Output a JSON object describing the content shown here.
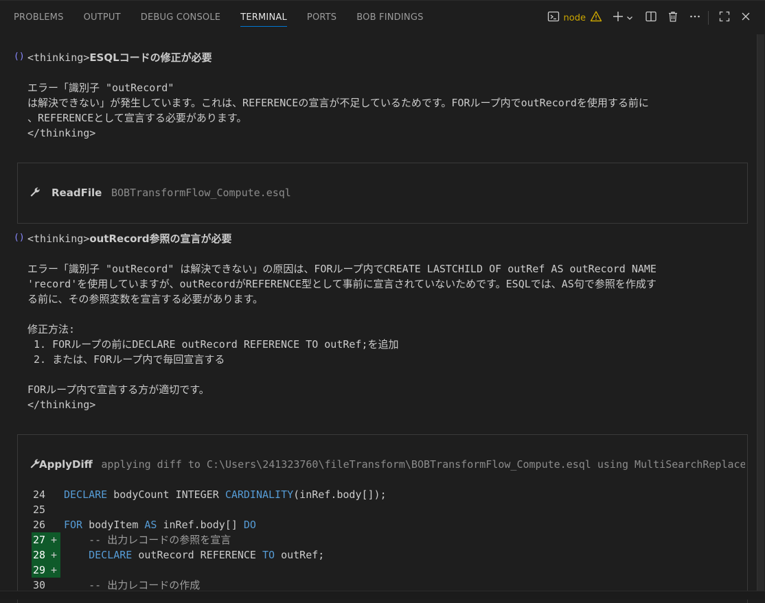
{
  "panel": {
    "tabs": [
      "PROBLEMS",
      "OUTPUT",
      "DEBUG CONSOLE",
      "TERMINAL",
      "PORTS",
      "BOB FINDINGS"
    ],
    "active_tab": "TERMINAL",
    "terminal_name": "node",
    "accent_color": "#0078d4",
    "warning_color": "#cca700"
  },
  "blocks": {
    "thinking1": {
      "open_tag": "<thinking>",
      "heading": "ESQLコードの修正が必要",
      "lines": [
        "エラー「識別子 \"outRecord\"",
        "は解決できない」が発生しています。これは、REFERENCEの宣言が不足しているためです。FORループ内でoutRecordを使用する前に",
        "、REFERENCEとして宣言する必要があります。"
      ],
      "close_tag": "</thinking>"
    },
    "readfile": {
      "tool": "ReadFile",
      "arg": "BOBTransformFlow_Compute.esql"
    },
    "thinking2": {
      "open_tag": "<thinking>",
      "heading": "outRecord参照の宣言が必要",
      "lines": [
        "エラー「識別子 \"outRecord\" は解決できない」の原因は、FORループ内でCREATE LASTCHILD OF outRef AS outRecord NAME",
        "'record'を使用していますが、outRecordがREFERENCE型として事前に宣言されていないためです。ESQLでは、AS句で参照を作成す",
        "る前に、その参照変数を宣言する必要があります。",
        "",
        "修正方法:",
        " 1. FORループの前にDECLARE outRecord REFERENCE TO outRef;を追加",
        " 2. または、FORループ内で毎回宣言する",
        "",
        "FORループ内で宣言する方が適切です。"
      ],
      "close_tag": "</thinking>"
    },
    "applydiff": {
      "tool": "ApplyDiff",
      "arg": "applying diff to C:\\Users\\241323760\\fileTransform\\BOBTransformFlow_Compute.esql using MultiSearchReplace…",
      "code_lines": [
        {
          "num": "24",
          "added": false,
          "tokens": [
            {
              "t": "DECLARE",
              "k": "kw"
            },
            {
              "t": " bodyCount ",
              "k": ""
            },
            {
              "t": "INTEGER",
              "k": ""
            },
            {
              "t": " ",
              "k": ""
            },
            {
              "t": "CARDINALITY",
              "k": "kw"
            },
            {
              "t": "(inRef.body[]);",
              "k": ""
            }
          ]
        },
        {
          "num": "25",
          "added": false,
          "tokens": []
        },
        {
          "num": "26",
          "added": false,
          "tokens": [
            {
              "t": "FOR",
              "k": "kw"
            },
            {
              "t": " bodyItem ",
              "k": ""
            },
            {
              "t": "AS",
              "k": "kw"
            },
            {
              "t": " inRef.body[] ",
              "k": ""
            },
            {
              "t": "DO",
              "k": "kw"
            }
          ]
        },
        {
          "num": "27",
          "added": true,
          "tokens": [
            {
              "t": "    -- 出力レコードの参照を宣言",
              "k": "cmt"
            }
          ]
        },
        {
          "num": "28",
          "added": true,
          "tokens": [
            {
              "t": "    ",
              "k": ""
            },
            {
              "t": "DECLARE",
              "k": "kw"
            },
            {
              "t": " outRecord REFERENCE ",
              "k": ""
            },
            {
              "t": "TO",
              "k": "kw"
            },
            {
              "t": " outRef;",
              "k": ""
            }
          ]
        },
        {
          "num": "29",
          "added": true,
          "tokens": []
        },
        {
          "num": "30",
          "added": false,
          "tokens": [
            {
              "t": "    -- 出力レコードの作成",
              "k": "cmt"
            }
          ]
        }
      ]
    }
  }
}
